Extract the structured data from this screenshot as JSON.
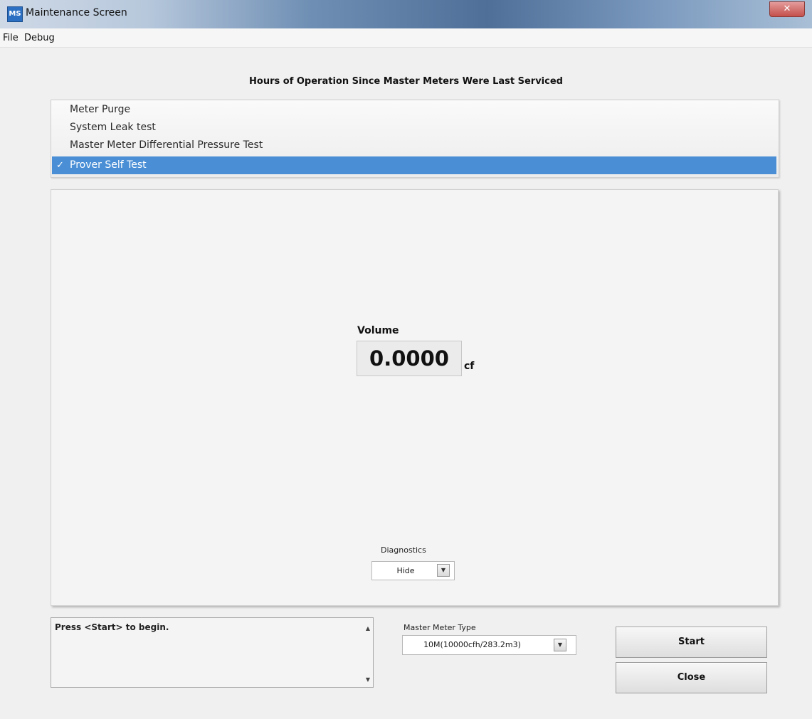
{
  "window": {
    "title": "Maintenance Screen",
    "icon": "app-icon"
  },
  "menu": {
    "items": [
      "File",
      "Debug"
    ]
  },
  "heading": "Hours of Operation Since Master Meters Were Last Serviced",
  "tests": [
    {
      "label": "Meter Purge",
      "selected": false
    },
    {
      "label": "System Leak test",
      "selected": false
    },
    {
      "label": "Master Meter Differential Pressure Test",
      "selected": false
    },
    {
      "label": "Prover Self Test",
      "selected": true
    }
  ],
  "volume": {
    "label": "Volume",
    "value": "0.0000",
    "unit": "cf"
  },
  "diagnostics": {
    "label": "Diagnostics",
    "selected": "Hide"
  },
  "status": {
    "text": "Press <Start> to begin."
  },
  "master_meter": {
    "label": "Master Meter Type",
    "selected": "10M(10000cfh/283.2m3)"
  },
  "buttons": {
    "start": "Start",
    "close": "Close"
  },
  "colors": {
    "selection": "#4a8fd6",
    "titlebar": "#4f6f99"
  }
}
